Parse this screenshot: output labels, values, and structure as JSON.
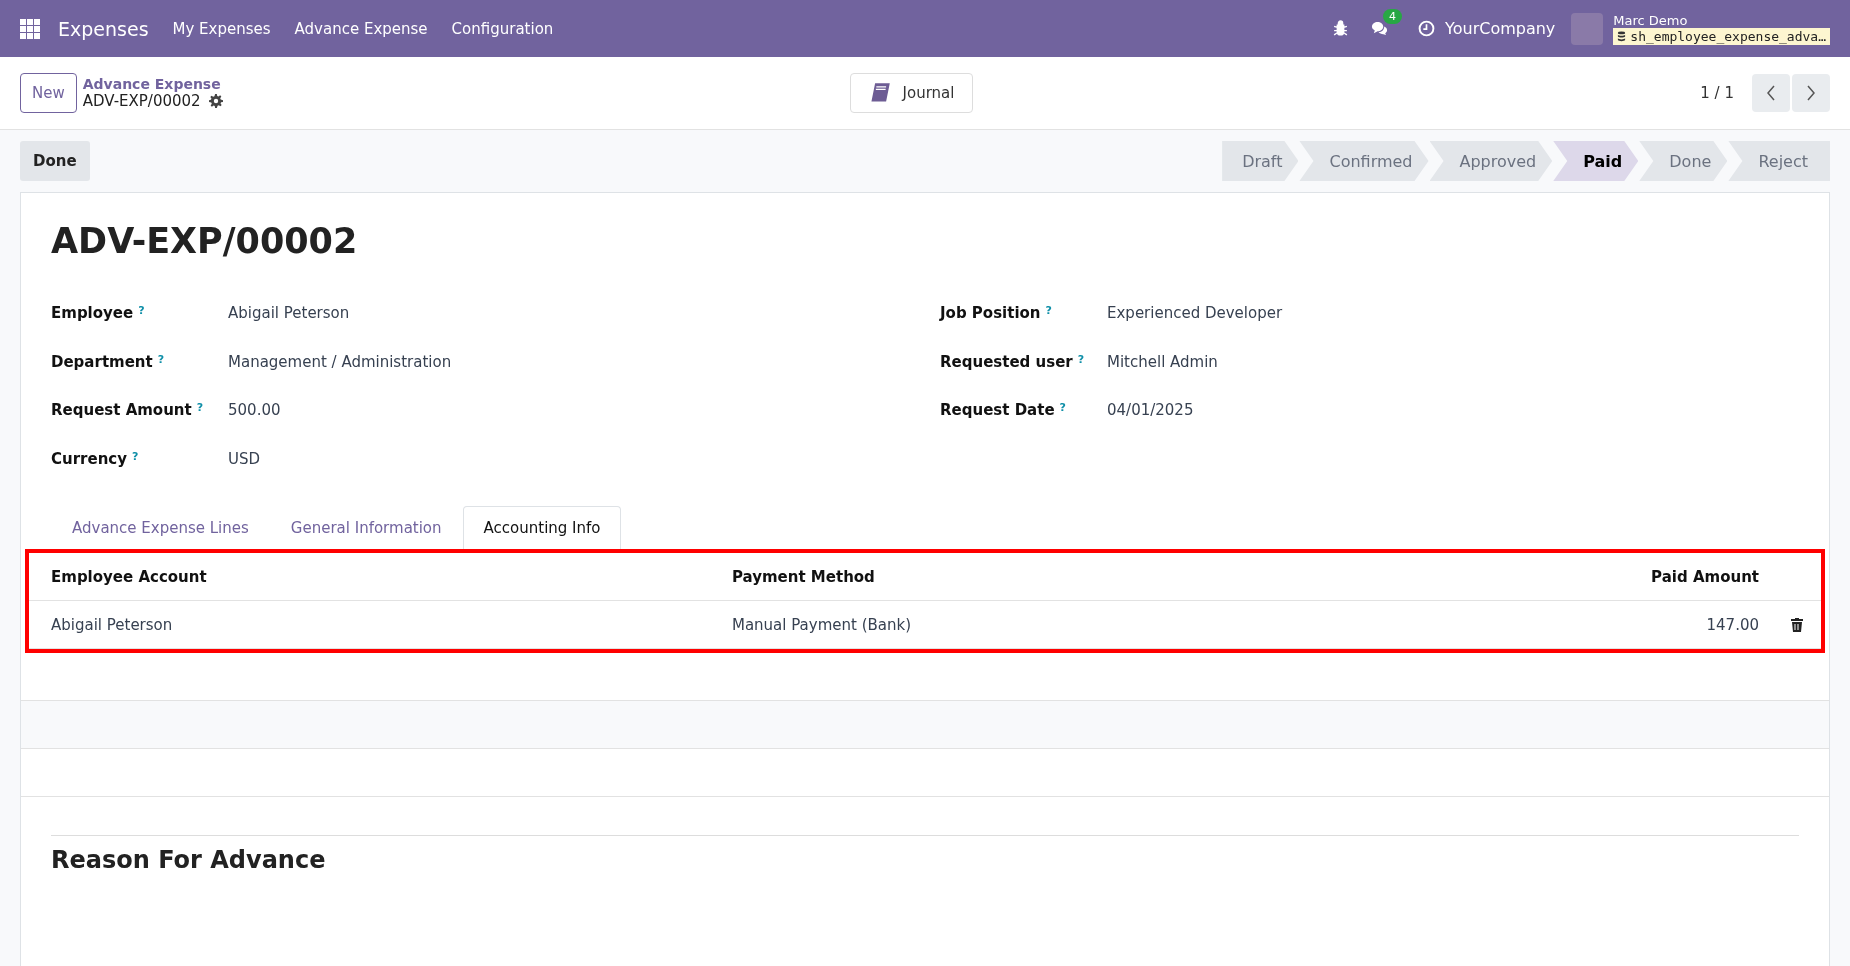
{
  "navbar": {
    "app_name": "Expenses",
    "menu": [
      "My Expenses",
      "Advance Expense",
      "Configuration"
    ],
    "message_count": "4",
    "company": "YourCompany",
    "user": "Marc Demo",
    "database": "sh_employee_expense_adva…"
  },
  "control_panel": {
    "new_button": "New",
    "breadcrumb": "Advance Expense",
    "record": "ADV-EXP/00002",
    "journal_button": "Journal",
    "pager": "1 / 1"
  },
  "action_button": "Done",
  "statusbar": [
    {
      "label": "Draft",
      "selected": false
    },
    {
      "label": "Confirmed",
      "selected": false
    },
    {
      "label": "Approved",
      "selected": false
    },
    {
      "label": "Paid",
      "selected": true
    },
    {
      "label": "Done",
      "selected": false
    },
    {
      "label": "Reject",
      "selected": false
    }
  ],
  "form": {
    "title": "ADV-EXP/00002",
    "left_fields": [
      {
        "label": "Employee",
        "help": "?",
        "value": "Abigail Peterson"
      },
      {
        "label": "Department",
        "help": "?",
        "value": "Management / Administration"
      },
      {
        "label": "Request Amount",
        "help": "?",
        "value": "500.00"
      },
      {
        "label": "Currency",
        "help": "?",
        "value": "USD"
      }
    ],
    "right_fields": [
      {
        "label": "Job Position",
        "help": "?",
        "value": "Experienced Developer"
      },
      {
        "label": "Requested user",
        "help": "?",
        "value": "Mitchell Admin"
      },
      {
        "label": "Request Date",
        "help": "?",
        "value": "04/01/2025"
      }
    ],
    "tabs": [
      {
        "label": "Advance Expense Lines",
        "selected": false
      },
      {
        "label": "General Information",
        "selected": false
      },
      {
        "label": "Accounting Info",
        "selected": true
      }
    ],
    "table": {
      "columns": [
        "Employee Account",
        "Payment Method",
        "Paid Amount"
      ],
      "rows": [
        [
          "Abigail Peterson",
          "Manual Payment (Bank)",
          "147.00"
        ]
      ]
    },
    "section_title": "Reason For Advance"
  }
}
